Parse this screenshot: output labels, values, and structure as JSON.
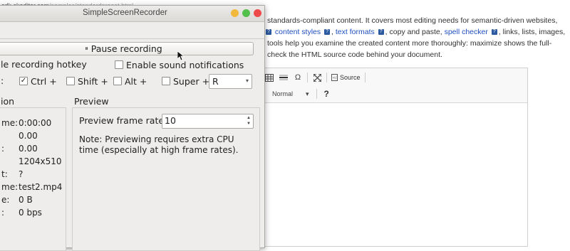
{
  "background": {
    "url_prefix": "sdk.ckeditor.com",
    "url_path": "/samples/standardpreset.html",
    "line1": "standards-compliant content. It covers most editing needs for semantic-driven websites,",
    "line2_links": [
      "content styles",
      "text formats"
    ],
    "line2_mid": "copy and paste,",
    "line2_link3": "spell checker",
    "line2_end": "links, lists, images,",
    "line3": "tools help you examine the created content more thoroughly: maximize shows the full-",
    "line4": "check the HTML source code behind your document.",
    "badge": "?",
    "toolbar": {
      "table_icon": "table-icon",
      "hr_icon": "horizontal-line-icon",
      "omega": "Ω",
      "maximize_icon": "maximize-icon",
      "source_label": "Source",
      "format_value": "Normal",
      "format_arrow": "▾",
      "help": "?"
    }
  },
  "window": {
    "title": "SimpleScreenRecorder",
    "menu_label": "g",
    "pause_button": "Pause recording",
    "pause_icon": "⏸",
    "options": {
      "hotkey_label": "le recording hotkey",
      "sound_label": "Enable sound notifications",
      "prefix": ":",
      "ctrl_checked": true,
      "ctrl_check": "✓",
      "ctrl_label": "Ctrl +",
      "shift_label": "Shift +",
      "alt_label": "Alt +",
      "super_label": "Super +",
      "key_value": "R",
      "key_arrow": "▾"
    },
    "info": {
      "title": "ion",
      "rows": [
        {
          "label": "me:",
          "value": "0:00:00"
        },
        {
          "label": "",
          "value": "0.00"
        },
        {
          "label": ":",
          "value": "0.00"
        },
        {
          "label": "",
          "value": "1204x510"
        },
        {
          "label": "t:",
          "value": "?"
        },
        {
          "label": "me:",
          "value": "test2.mp4"
        },
        {
          "label": "e:",
          "value": "0 B"
        },
        {
          "label": ":",
          "value": "0 bps"
        }
      ]
    },
    "preview": {
      "title": "Preview",
      "frame_rate_label": "Preview frame rate:",
      "frame_rate_value": "10",
      "spin_up": "▲",
      "spin_down": "▼",
      "note": "Note: Previewing requires extra CPU time (especially at high frame rates)."
    }
  }
}
